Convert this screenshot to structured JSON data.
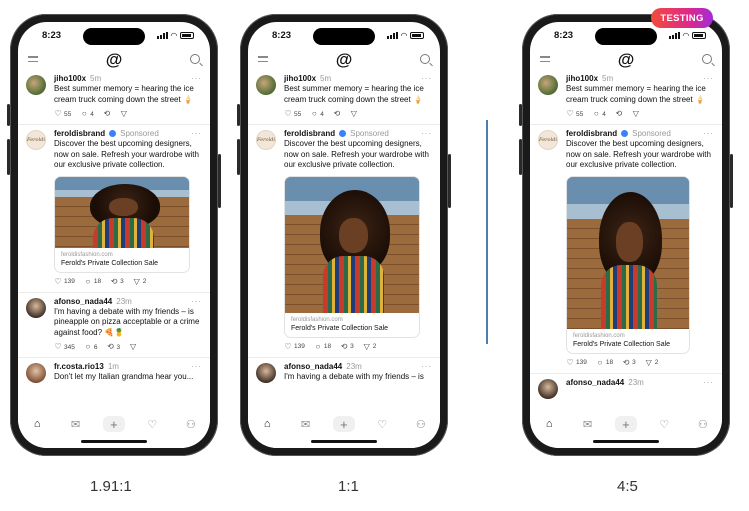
{
  "phones": [
    {
      "id": "p1",
      "caption": "1.91:1",
      "time": "8:23",
      "image_aspect": "1.91:1",
      "posts": {
        "jiho": {
          "username": "jiho100x",
          "time": "5m",
          "text": "Best summer memory = hearing the ice cream truck coming down the street 🍦",
          "likes": "55",
          "replies": "4"
        },
        "ad": {
          "username": "feroldisbrand",
          "sponsored": "Sponsored",
          "text": "Discover the best upcoming designers, now on sale. Refresh your wardrobe with our exclusive private collection.",
          "domain": "feroldisfashion.com",
          "card_title": "Ferold's Private Collection Sale",
          "likes": "139",
          "replies": "18",
          "reposts": "3",
          "shares": "2"
        },
        "afonso": {
          "username": "afonso_nada44",
          "time": "23m",
          "text": "I'm having a debate with my friends – is pineapple on pizza acceptable or a crime against food? 🍕🍍",
          "likes": "345",
          "replies": "6",
          "reposts": "3"
        },
        "fr": {
          "username": "fr.costa.rio13",
          "time": "1m",
          "text": "Don't let my Italian grandma hear you..."
        }
      }
    },
    {
      "id": "p2",
      "caption": "1:1",
      "time": "8:23",
      "image_aspect": "1:1",
      "posts": {
        "jiho": {
          "username": "jiho100x",
          "time": "5m",
          "text": "Best summer memory = hearing the ice cream truck coming down the street 🍦",
          "likes": "55",
          "replies": "4"
        },
        "ad": {
          "username": "feroldisbrand",
          "sponsored": "Sponsored",
          "text": "Discover the best upcoming designers, now on sale. Refresh your wardrobe with our exclusive private collection.",
          "domain": "feroldisfashion.com",
          "card_title": "Ferold's Private Collection Sale",
          "likes": "139",
          "replies": "18",
          "reposts": "3",
          "shares": "2"
        },
        "afonso": {
          "username": "afonso_nada44",
          "time": "23m",
          "text": "I'm having a debate with my friends – is"
        }
      }
    },
    {
      "id": "p3",
      "caption": "4:5",
      "time": "8:23",
      "image_aspect": "4:5",
      "badge": "TESTING",
      "posts": {
        "jiho": {
          "username": "jiho100x",
          "time": "5m",
          "text": "Best summer memory = hearing the ice cream truck coming down the street 🍦",
          "likes": "55",
          "replies": "4"
        },
        "ad": {
          "username": "feroldisbrand",
          "sponsored": "Sponsored",
          "text": "Discover the best upcoming designers, now on sale. Refresh your wardrobe with our exclusive private collection.",
          "domain": "feroldisfashion.com",
          "card_title": "Ferold's Private Collection Sale",
          "likes": "139",
          "replies": "18",
          "reposts": "3",
          "shares": "2"
        },
        "afonso": {
          "username": "afonso_nada44",
          "time": "23m"
        }
      }
    }
  ],
  "icons": {
    "logo": "threads-logo-icon",
    "menu": "menu-icon",
    "search": "search-icon",
    "like": "heart-icon",
    "reply": "comment-icon",
    "repost": "repost-icon",
    "share": "send-icon",
    "tabs": [
      "home-icon",
      "inbox-icon",
      "plus-icon",
      "heart-icon",
      "profile-icon"
    ]
  },
  "colors": {
    "badge_gradient_start": "#f24b3a",
    "badge_gradient_end": "#a12ad8",
    "divider": "#4a7fb0",
    "verified": "#3b82f6"
  }
}
